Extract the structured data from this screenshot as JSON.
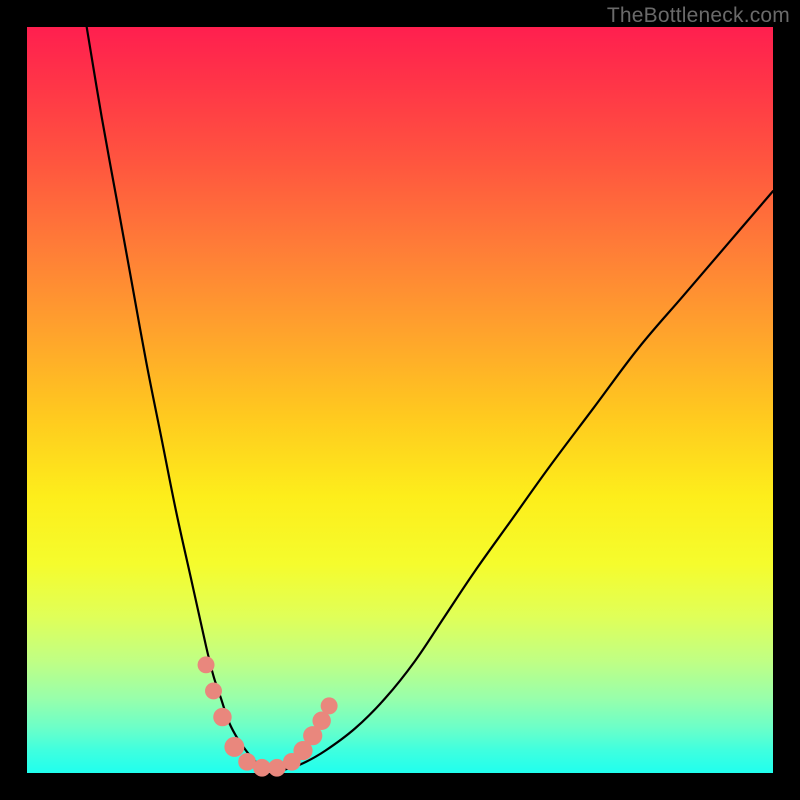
{
  "watermark": "TheBottleneck.com",
  "chart_data": {
    "type": "line",
    "title": "",
    "xlabel": "",
    "ylabel": "",
    "xlim": [
      0,
      100
    ],
    "ylim": [
      0,
      100
    ],
    "grid": false,
    "series": [
      {
        "name": "curve",
        "color": "#000000",
        "x": [
          8,
          10,
          12,
          14,
          16,
          18,
          20,
          22,
          24,
          25,
          26,
          27,
          28,
          29,
          30,
          31,
          32,
          33,
          34,
          35,
          37,
          40,
          44,
          48,
          52,
          56,
          60,
          65,
          70,
          76,
          82,
          88,
          94,
          100
        ],
        "values": [
          100,
          88,
          77,
          66,
          55,
          45,
          35,
          26,
          17,
          13,
          10,
          7,
          5,
          3.5,
          2.2,
          1.2,
          0.6,
          0.3,
          0.3,
          0.6,
          1.3,
          3,
          6,
          10,
          15,
          21,
          27,
          34,
          41,
          49,
          57,
          64,
          71,
          78
        ]
      }
    ],
    "markers": [
      {
        "x": 24.0,
        "y": 14.5,
        "r": 1.2
      },
      {
        "x": 25.0,
        "y": 11.0,
        "r": 1.2
      },
      {
        "x": 26.2,
        "y": 7.5,
        "r": 1.4
      },
      {
        "x": 27.8,
        "y": 3.5,
        "r": 1.6
      },
      {
        "x": 29.5,
        "y": 1.5,
        "r": 1.3
      },
      {
        "x": 31.5,
        "y": 0.7,
        "r": 1.3
      },
      {
        "x": 33.5,
        "y": 0.7,
        "r": 1.3
      },
      {
        "x": 35.5,
        "y": 1.5,
        "r": 1.3
      },
      {
        "x": 37.0,
        "y": 3.0,
        "r": 1.5
      },
      {
        "x": 38.3,
        "y": 5.0,
        "r": 1.5
      },
      {
        "x": 39.5,
        "y": 7.0,
        "r": 1.4
      },
      {
        "x": 40.5,
        "y": 9.0,
        "r": 1.2
      }
    ],
    "marker_color": "#e9877d"
  }
}
